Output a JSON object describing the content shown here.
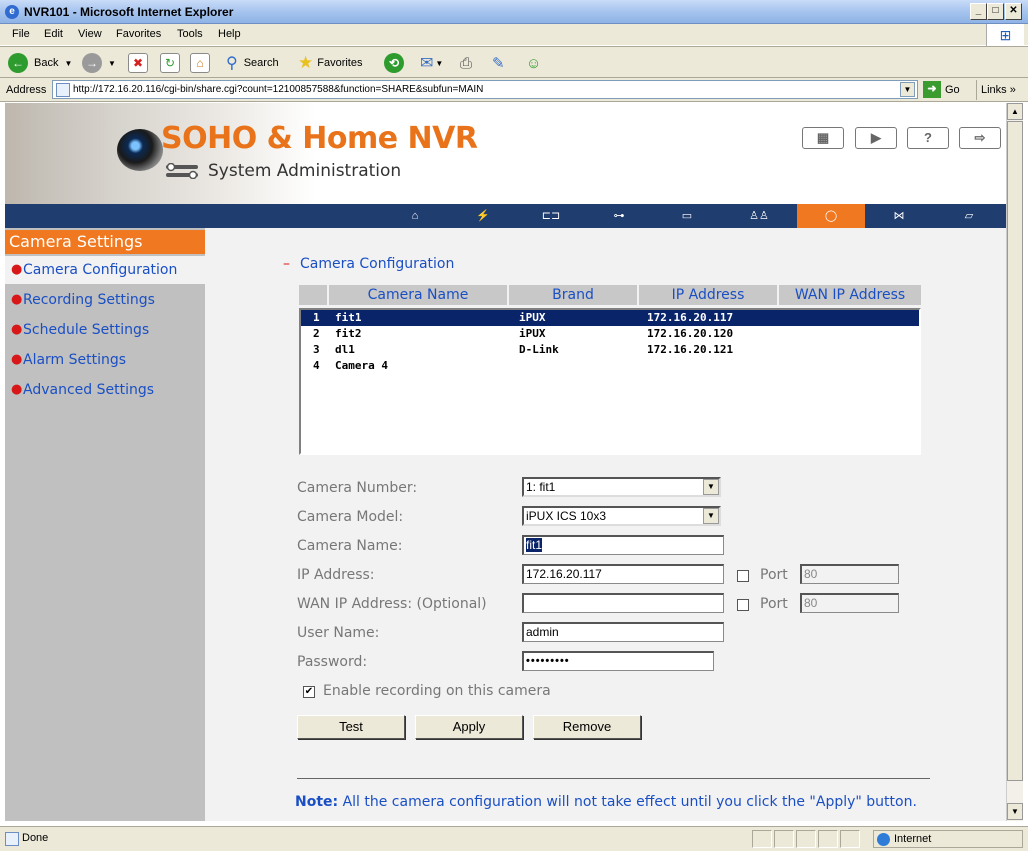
{
  "window": {
    "title": "NVR101 - Microsoft Internet Explorer"
  },
  "menu": [
    "File",
    "Edit",
    "View",
    "Favorites",
    "Tools",
    "Help"
  ],
  "toolbar": {
    "back": "Back",
    "search": "Search",
    "favorites": "Favorites"
  },
  "address": {
    "label": "Address",
    "url": "http://172.16.20.116/cgi-bin/share.cgi?count=12100857588&function=SHARE&subfun=MAIN",
    "go": "Go",
    "links": "Links"
  },
  "header": {
    "brand": "SOHO & Home NVR",
    "subtitle": "System Administration"
  },
  "sidebar": {
    "heading": "Camera Settings",
    "items": [
      "Camera Configuration",
      "Recording Settings",
      "Schedule Settings",
      "Alarm Settings",
      "Advanced Settings"
    ]
  },
  "main": {
    "section_title": "Camera Configuration",
    "table": {
      "headers": [
        "Camera Name",
        "Brand",
        "IP Address",
        "WAN IP Address"
      ],
      "rows": [
        {
          "num": "1",
          "name": "fit1",
          "brand": "iPUX",
          "ip": "172.16.20.117",
          "selected": true
        },
        {
          "num": "2",
          "name": "fit2",
          "brand": "iPUX",
          "ip": "172.16.20.120"
        },
        {
          "num": "3",
          "name": "dl1",
          "brand": "D-Link",
          "ip": "172.16.20.121"
        },
        {
          "num": "4",
          "name": "Camera 4",
          "brand": "",
          "ip": ""
        }
      ]
    },
    "form": {
      "camera_number_label": "Camera Number:",
      "camera_number_value": "1: fit1",
      "camera_model_label": "Camera Model:",
      "camera_model_value": "iPUX ICS 10x3",
      "camera_name_label": "Camera Name:",
      "camera_name_value": "fit1",
      "ip_label": "IP Address:",
      "ip_value": "172.16.20.117",
      "wan_label": "WAN IP Address: (Optional)",
      "wan_value": "",
      "port_label": "Port",
      "port_value": "80",
      "user_label": "User Name:",
      "user_value": "admin",
      "password_label": "Password:",
      "password_value": "•••••••••",
      "enable_label": "Enable recording on this camera",
      "enable_checked": true
    },
    "buttons": {
      "test": "Test",
      "apply": "Apply",
      "remove": "Remove"
    },
    "note_label": "Note:",
    "note_text": " All the camera configuration will not take effect until you click the \"Apply\" button."
  },
  "status": {
    "text": "Done",
    "zone": "Internet"
  }
}
